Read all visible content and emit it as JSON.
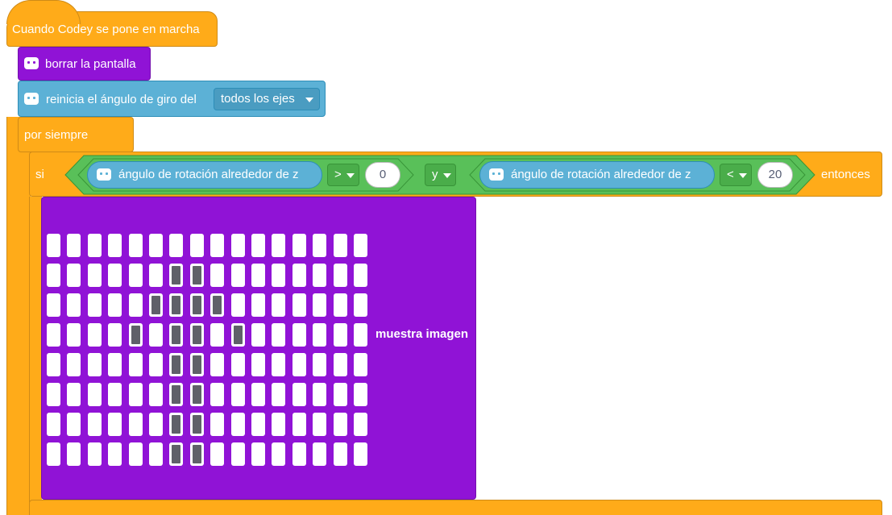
{
  "event": {
    "label": "Cuando Codey se pone en marcha"
  },
  "clear_screen": {
    "label": "borrar la pantalla"
  },
  "reset_angle": {
    "label": "reinicia el ángulo de giro del",
    "axis_value": "todos los ejes"
  },
  "forever": {
    "label": "por siempre"
  },
  "if_block": {
    "if_label": "si",
    "then_label": "entonces",
    "cond1": {
      "label": "ángulo de rotación alrededor de z",
      "operator": ">",
      "value": "0"
    },
    "logic": "y",
    "cond2": {
      "label": "ángulo de rotación alrededor de z",
      "operator": "<",
      "value": "20"
    }
  },
  "show_image": {
    "label": "muestra imagen",
    "matrix": [
      [
        0,
        0,
        0,
        0,
        0,
        0,
        0,
        0,
        0,
        0,
        0,
        0,
        0,
        0,
        0,
        0
      ],
      [
        0,
        0,
        0,
        0,
        0,
        0,
        1,
        1,
        0,
        0,
        0,
        0,
        0,
        0,
        0,
        0
      ],
      [
        0,
        0,
        0,
        0,
        0,
        1,
        1,
        1,
        1,
        0,
        0,
        0,
        0,
        0,
        0,
        0
      ],
      [
        0,
        0,
        0,
        0,
        1,
        0,
        1,
        1,
        0,
        1,
        0,
        0,
        0,
        0,
        0,
        0
      ],
      [
        0,
        0,
        0,
        0,
        0,
        0,
        1,
        1,
        0,
        0,
        0,
        0,
        0,
        0,
        0,
        0
      ],
      [
        0,
        0,
        0,
        0,
        0,
        0,
        1,
        1,
        0,
        0,
        0,
        0,
        0,
        0,
        0,
        0
      ],
      [
        0,
        0,
        0,
        0,
        0,
        0,
        1,
        1,
        0,
        0,
        0,
        0,
        0,
        0,
        0,
        0
      ],
      [
        0,
        0,
        0,
        0,
        0,
        0,
        1,
        1,
        0,
        0,
        0,
        0,
        0,
        0,
        0,
        0
      ]
    ]
  },
  "colors": {
    "event_orange": "#ffab19",
    "looks_purple": "#9013d6",
    "sensing_blue": "#5cb1d6",
    "operator_green": "#59c059",
    "led_on": "#5f6069",
    "led_off": "#ffffff"
  },
  "icons": {
    "codey_block_icon": "robot-face-icon",
    "dropdown_caret": "caret-down-icon"
  }
}
